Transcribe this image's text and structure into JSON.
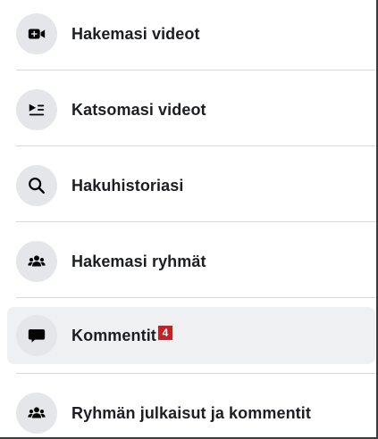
{
  "menu": {
    "items": [
      {
        "label": "Hakemasi videot",
        "icon": "video-camera-icon"
      },
      {
        "label": "Katsomasi videot",
        "icon": "watch-list-icon"
      },
      {
        "label": "Hakuhistoriasi",
        "icon": "search-icon"
      },
      {
        "label": "Hakemasi ryhmät",
        "icon": "groups-icon"
      },
      {
        "label": "Kommentit",
        "icon": "comment-bubble-icon",
        "badge": "4"
      },
      {
        "label": "Ryhmän julkaisut ja kommentit",
        "icon": "groups-icon"
      }
    ]
  },
  "colors": {
    "badge": "#c81f25",
    "active_row": "#eef0f2",
    "icon_circle": "#e4e6ea",
    "text": "#1c1e21"
  }
}
